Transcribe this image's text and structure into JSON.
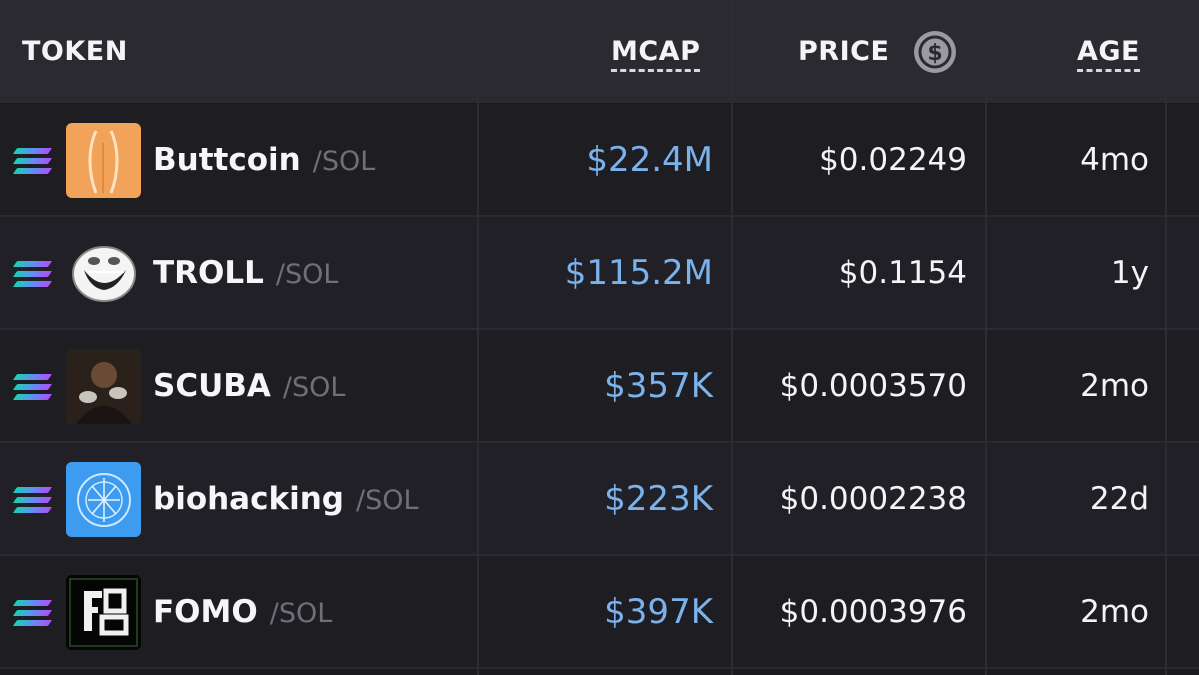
{
  "header": {
    "token": "TOKEN",
    "mcap": "MCAP",
    "price": "PRICE",
    "age": "AGE",
    "currency_icon": "dollar-circle-icon"
  },
  "chain_icon": "solana-icon",
  "rows": [
    {
      "name": "Buttcoin",
      "pair": "/SOL",
      "mcap": "$22.4M",
      "price": "$0.02249",
      "age": "4mo",
      "avatar_color": "#f2a35a"
    },
    {
      "name": "TROLL",
      "pair": "/SOL",
      "mcap": "$115.2M",
      "price": "$0.1154",
      "age": "1y",
      "avatar_color": "#ffffff"
    },
    {
      "name": "SCUBA",
      "pair": "/SOL",
      "mcap": "$357K",
      "price": "$0.0003570",
      "age": "2mo",
      "avatar_color": "#3a2c24"
    },
    {
      "name": "biohacking",
      "pair": "/SOL",
      "mcap": "$223K",
      "price": "$0.0002238",
      "age": "22d",
      "avatar_color": "#3d9bf0"
    },
    {
      "name": "FOMO",
      "pair": "/SOL",
      "mcap": "$397K",
      "price": "$0.0003976",
      "age": "2mo",
      "avatar_color": "#0a0a0a"
    }
  ],
  "colors": {
    "mcap": "#7cb2ec",
    "background": "#1b1b20",
    "header": "#2a2a30"
  }
}
